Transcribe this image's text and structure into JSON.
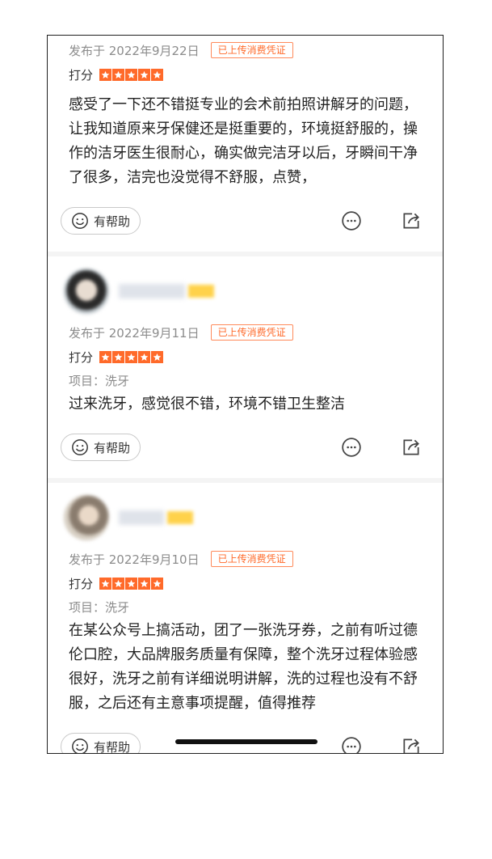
{
  "colors": {
    "accent": "#ff6a2a",
    "star": "#ff6a2a",
    "muted_text": "#8c8c8c"
  },
  "common": {
    "rating_label": "打分",
    "helpful_label": "有帮助",
    "badge_text": "已上传消费凭证",
    "project_label": "项目：洗牙"
  },
  "reviews": [
    {
      "date": "发布于 2022年9月22日",
      "stars": 5,
      "content": "感受了一下还不错挺专业的会术前拍照讲解牙的问题，让我知道原来牙保健还是挺重要的，环境挺舒服的，操作的洁牙医生很耐心，确实做完洁牙以后，牙瞬间干净了很多，洁完也没觉得不舒服，点赞，"
    },
    {
      "date": "发布于 2022年9月11日",
      "stars": 5,
      "content": "过来洗牙，感觉很不错，环境不错卫生整洁"
    },
    {
      "date": "发布于 2022年9月10日",
      "stars": 5,
      "content": "在某公众号上搞活动，团了一张洗牙券，之前有听过德伦口腔，大品牌服务质量有保障，整个洗牙过程体验感很好，洗牙之前有详细说明讲解，洗的过程也没有不舒服，之后还有主意事项提醒，值得推荐"
    }
  ]
}
